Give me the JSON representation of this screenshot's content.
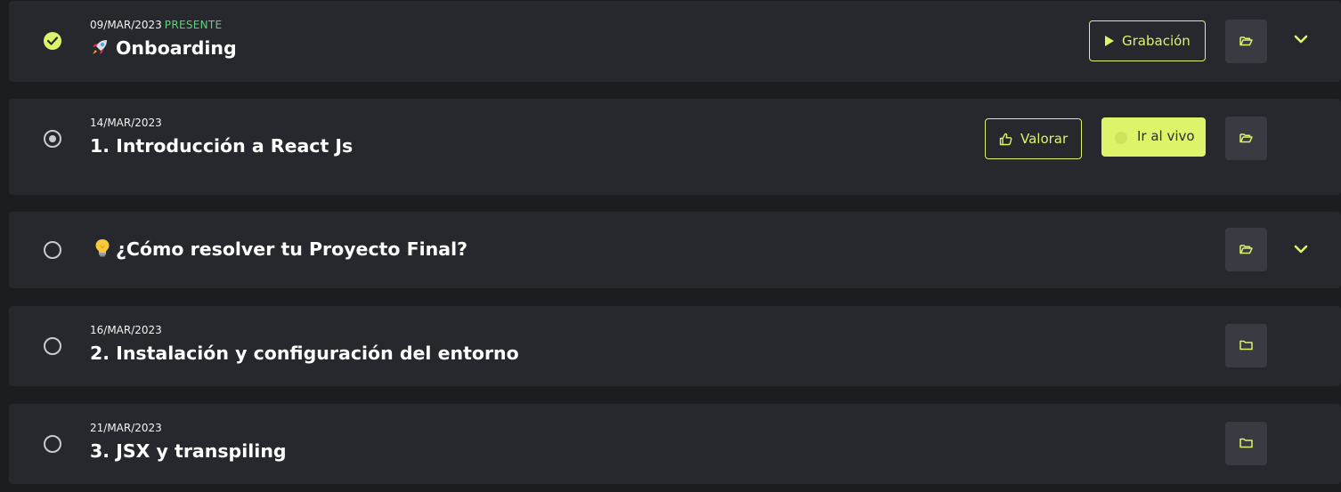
{
  "colors": {
    "accent": "#dcf36a",
    "present": "#5fd17a",
    "row_bg": "#27282e",
    "page_bg": "#1c1d21"
  },
  "classes": [
    {
      "status": "completed",
      "date": "09/MAR/2023",
      "badge": "PRESENTE",
      "emoji_icon": "rocket-icon",
      "title": "Onboarding",
      "recording_label": "Grabación",
      "expandable": true
    },
    {
      "status": "current",
      "date": "14/MAR/2023",
      "title": "1. Introducción a React Js",
      "rate_label": "Valorar",
      "live_label": "Ir al vivo"
    },
    {
      "status": "pending",
      "emoji_icon": "lightbulb-icon",
      "title": "¿Cómo resolver tu Proyecto Final?",
      "expandable": true
    },
    {
      "status": "pending",
      "date": "16/MAR/2023",
      "title": "2. Instalación y configuración del entorno"
    },
    {
      "status": "pending",
      "date": "21/MAR/2023",
      "title": "3. JSX y transpiling"
    }
  ]
}
